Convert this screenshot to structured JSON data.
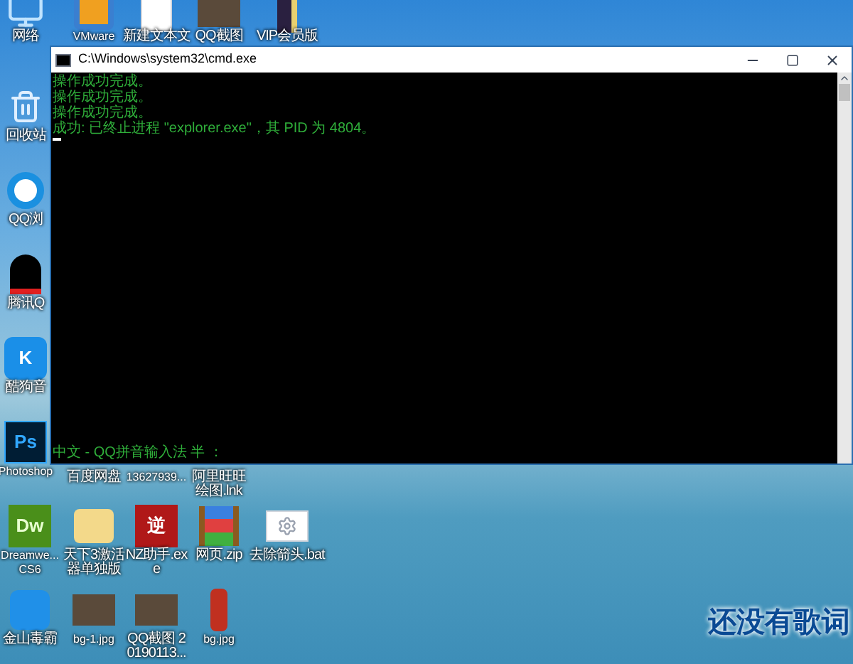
{
  "desktop_icons": [
    {
      "label": "网络",
      "kind": "network"
    },
    {
      "label": "VMware",
      "kind": "vmware"
    },
    {
      "label": "新建文本文",
      "kind": "document"
    },
    {
      "label": "QQ截图",
      "kind": "photo"
    },
    {
      "label": "VIP会员版",
      "kind": "tall"
    },
    {
      "label": "回收站",
      "kind": "recycle"
    },
    {
      "label": "QQ浏",
      "kind": "browser"
    },
    {
      "label": "腾讯Q",
      "kind": "penguin"
    },
    {
      "label": "酷狗音",
      "kind": "glyph",
      "glyph": "K"
    },
    {
      "label": "Photoshop",
      "kind": "glyph",
      "glyph": "Ps"
    },
    {
      "label": "百度网盘",
      "kind": "hidden"
    },
    {
      "label": "13627939...",
      "kind": "hidden"
    },
    {
      "label": "阿里旺旺绘图.lnk",
      "kind": "hidden"
    },
    {
      "label": "Dreamwe... CS6",
      "kind": "glyph",
      "glyph": "Dw"
    },
    {
      "label": "天下3激活器单独版",
      "kind": "folder"
    },
    {
      "label": "NZ助手.exe",
      "kind": "glyph",
      "glyph": "逆"
    },
    {
      "label": "网页.zip",
      "kind": "archive"
    },
    {
      "label": "去除箭头.bat",
      "kind": "gear"
    },
    {
      "label": "金山毒霸",
      "kind": "duba"
    },
    {
      "label": "bg-1.jpg",
      "kind": "photo"
    },
    {
      "label": "QQ截图 20190113...",
      "kind": "photo"
    },
    {
      "label": "bg.jpg",
      "kind": "bottle"
    }
  ],
  "window": {
    "title": "C:\\Windows\\system32\\cmd.exe",
    "console_lines": [
      "操作成功完成。",
      "操作成功完成。",
      "操作成功完成。",
      "成功: 已终止进程 \"explorer.exe\"，其 PID 为 4804。"
    ],
    "ime_status": "中文 - QQ拼音输入法 半 ："
  },
  "lyrics": "还没有歌词"
}
